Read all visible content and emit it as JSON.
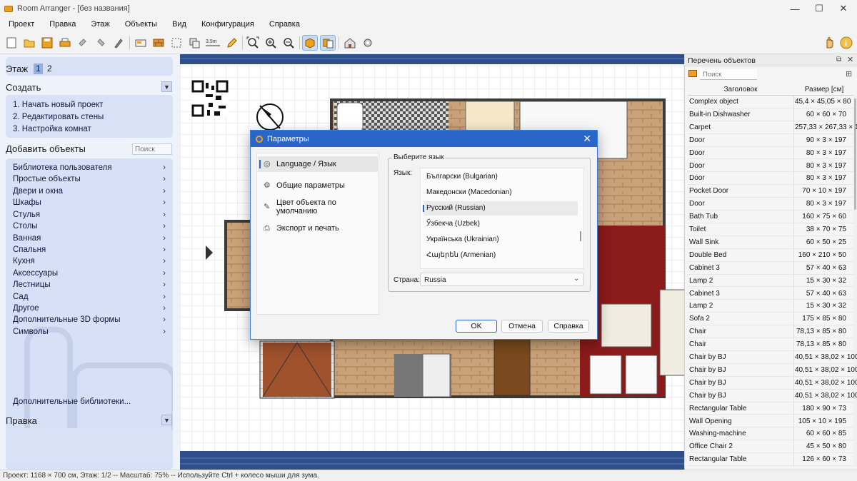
{
  "window": {
    "title": "Room Arranger - [без названия]"
  },
  "menu": [
    "Проект",
    "Правка",
    "Этаж",
    "Объекты",
    "Вид",
    "Конфигурация",
    "Справка"
  ],
  "left": {
    "floor_label": "Этаж",
    "floors": [
      "1",
      "2"
    ],
    "create_title": "Создать",
    "create_items": [
      "1. Начать новый проект",
      "2. Редактировать стены",
      "3. Настройка комнат"
    ],
    "add_title": "Добавить объекты",
    "search_placeholder": "Поиск",
    "categories": [
      "Библиотека пользователя",
      "Простые объекты",
      "Двери и окна",
      "Шкафы",
      "Стулья",
      "Столы",
      "Ванная",
      "Спальня",
      "Кухня",
      "Аксессуары",
      "Лестницы",
      "Сад",
      "Другое",
      "Дополнительные 3D формы",
      "Символы"
    ],
    "more_libraries": "Дополнительные библиотеки...",
    "edit_title": "Правка"
  },
  "right": {
    "title": "Перечень объектов",
    "search_placeholder": "Поиск",
    "col_name": "Заголовок",
    "col_size": "Размер [см]",
    "rows": [
      {
        "name": "Complex object",
        "size": "45,4 × 45,05 × 80"
      },
      {
        "name": "Built-in Dishwasher",
        "size": "60 × 60 × 70"
      },
      {
        "name": "Carpet",
        "size": "257,33 × 267,33 × 1"
      },
      {
        "name": "Door",
        "size": "90 × 3 × 197"
      },
      {
        "name": "Door",
        "size": "80 × 3 × 197"
      },
      {
        "name": "Door",
        "size": "80 × 3 × 197"
      },
      {
        "name": "Door",
        "size": "80 × 3 × 197"
      },
      {
        "name": "Pocket Door",
        "size": "70 × 10 × 197"
      },
      {
        "name": "Door",
        "size": "80 × 3 × 197"
      },
      {
        "name": "Bath Tub",
        "size": "160 × 75 × 60"
      },
      {
        "name": "Toilet",
        "size": "38 × 70 × 75"
      },
      {
        "name": "Wall Sink",
        "size": "60 × 50 × 25"
      },
      {
        "name": "Double Bed",
        "size": "160 × 210 × 50"
      },
      {
        "name": "Cabinet 3",
        "size": "57 × 40 × 63"
      },
      {
        "name": "Lamp 2",
        "size": "15 × 30 × 32"
      },
      {
        "name": "Cabinet 3",
        "size": "57 × 40 × 63"
      },
      {
        "name": "Lamp 2",
        "size": "15 × 30 × 32"
      },
      {
        "name": "Sofa 2",
        "size": "175 × 85 × 80"
      },
      {
        "name": "Chair",
        "size": "78,13 × 85 × 80"
      },
      {
        "name": "Chair",
        "size": "78,13 × 85 × 80"
      },
      {
        "name": "Chair by BJ",
        "size": "40,51 × 38,02 × 100"
      },
      {
        "name": "Chair by BJ",
        "size": "40,51 × 38,02 × 100"
      },
      {
        "name": "Chair by BJ",
        "size": "40,51 × 38,02 × 100"
      },
      {
        "name": "Chair by BJ",
        "size": "40,51 × 38,02 × 100"
      },
      {
        "name": "Rectangular Table",
        "size": "180 × 90 × 73"
      },
      {
        "name": "Wall Opening",
        "size": "105 × 10 × 195"
      },
      {
        "name": "Washing-machine",
        "size": "60 × 60 × 85"
      },
      {
        "name": "Office Chair 2",
        "size": "45 × 50 × 80"
      },
      {
        "name": "Rectangular Table",
        "size": "126 × 60 × 73"
      }
    ]
  },
  "status": "Проект: 1168 × 700 см, Этаж: 1/2 -- Масштаб: 75% -- Используйте Ctrl + колесо мыши для зума.",
  "dialog": {
    "title": "Параметры",
    "nav": [
      {
        "label": "Language / Язык",
        "icon": "globe-icon"
      },
      {
        "label": "Общие параметры",
        "icon": "gear-icon"
      },
      {
        "label": "Цвет объекта по умолчанию",
        "icon": "brush-icon"
      },
      {
        "label": "Экспорт и печать",
        "icon": "printer-icon"
      }
    ],
    "group_title": "Выберите язык",
    "language_label": "Язык:",
    "languages": [
      "Български (Bulgarian)",
      "Македонски (Macedonian)",
      "Русский (Russian)",
      "Ўзбекча (Uzbek)",
      "Українська (Ukrainian)",
      "Հայերեն (Armenian)"
    ],
    "selected_language": "Русский (Russian)",
    "country_label": "Страна:",
    "country_value": "Russia",
    "ok": "OK",
    "cancel": "Отмена",
    "help": "Справка"
  },
  "canvas": {
    "scale_label": "3.5m"
  }
}
